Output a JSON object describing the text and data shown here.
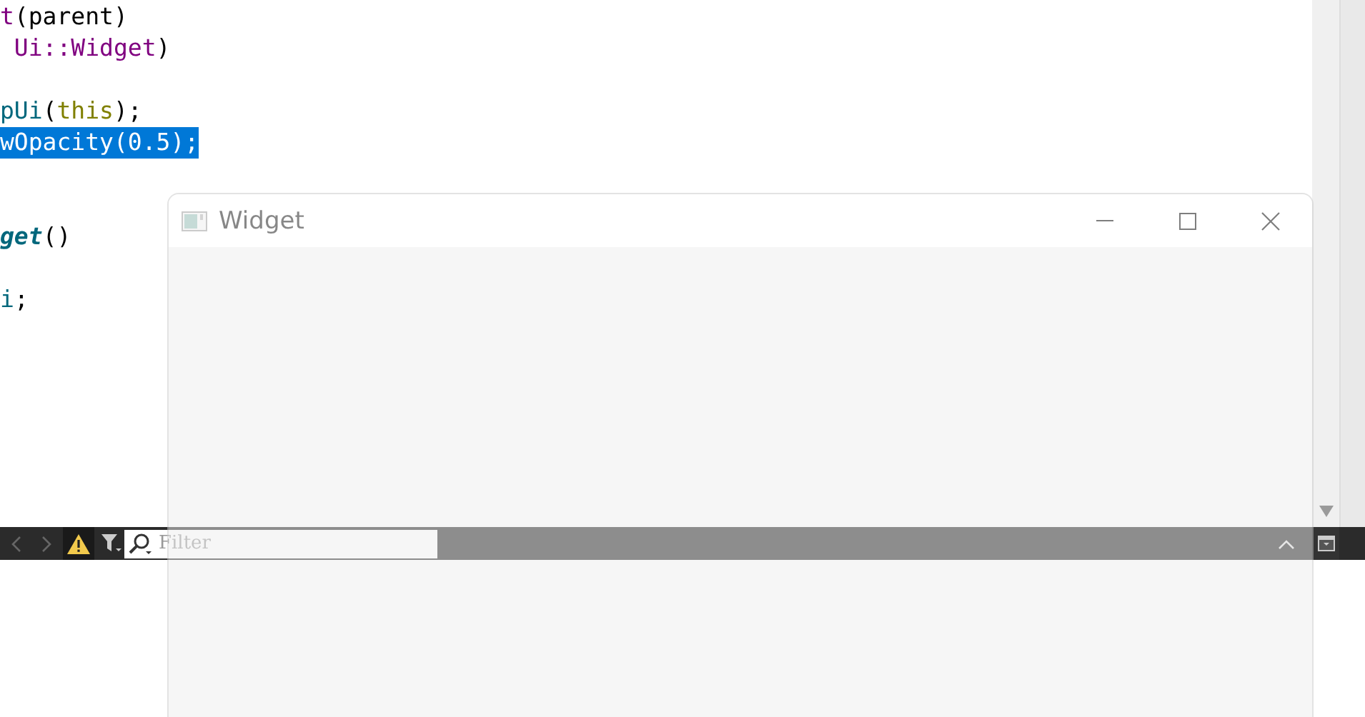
{
  "editor": {
    "lines": [
      {
        "selected": false,
        "tokens": [
          {
            "text": "t",
            "kind": "type"
          },
          {
            "text": "(parent)",
            "kind": "plain"
          }
        ]
      },
      {
        "selected": false,
        "tokens": [
          {
            "text": " Ui::Widget",
            "kind": "type"
          },
          {
            "text": ")",
            "kind": "plain"
          }
        ]
      },
      {
        "selected": false
      },
      {
        "selected": false,
        "tokens": [
          {
            "text": "pUi",
            "kind": "function"
          },
          {
            "text": "(",
            "kind": "plain"
          },
          {
            "text": "this",
            "kind": "keyword"
          },
          {
            "text": ");",
            "kind": "plain"
          }
        ]
      },
      {
        "selected": true,
        "tokens": [
          {
            "text": "wOpacity(0.5);",
            "kind": "plain"
          }
        ]
      },
      {
        "selected": false
      },
      {
        "selected": false
      },
      {
        "selected": false,
        "tokens": [
          {
            "text": "get",
            "kind": "declaration"
          },
          {
            "text": "()",
            "kind": "plain"
          }
        ]
      },
      {
        "selected": false
      },
      {
        "selected": false,
        "tokens": [
          {
            "text": "i",
            "kind": "function"
          },
          {
            "text": ";",
            "kind": "plain"
          }
        ]
      }
    ]
  },
  "toolbar": {
    "warning_toggle": {
      "on": true
    },
    "filter": {
      "placeholder": "Filter"
    }
  },
  "window": {
    "title": "Widget"
  }
}
